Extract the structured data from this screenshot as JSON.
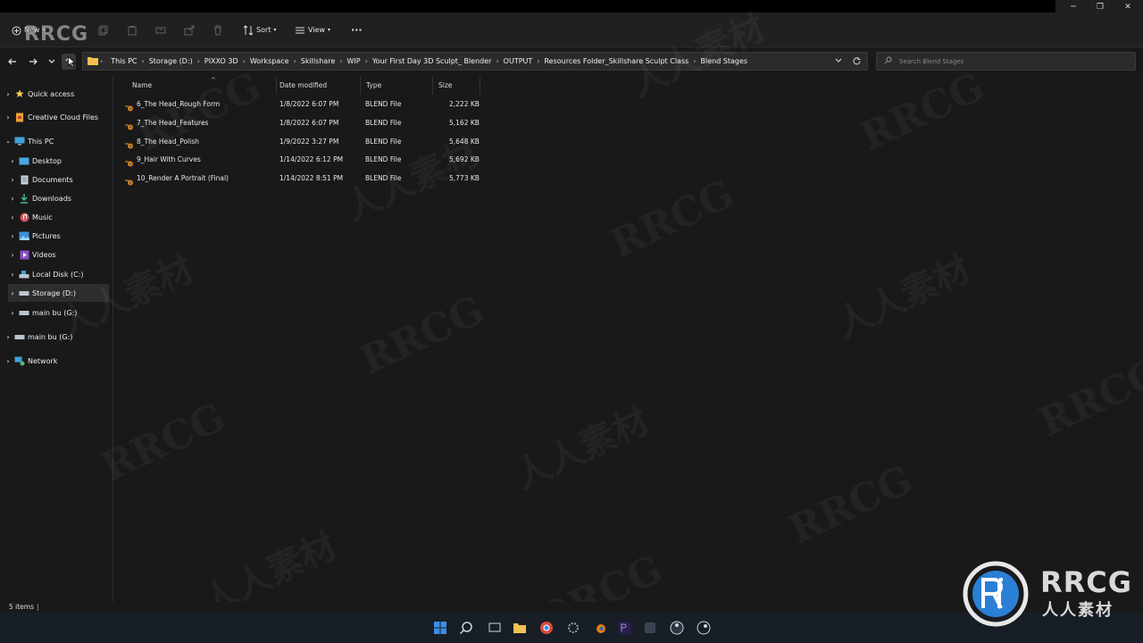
{
  "logo_text": "RRCG",
  "toolbar": {
    "new_label": "New",
    "sort_label": "Sort",
    "view_label": "View",
    "more_label": "···"
  },
  "address": {
    "crumbs": [
      "This PC",
      "Storage (D:)",
      "PIXXO 3D",
      "Workspace",
      "Skillshare",
      "WIP",
      "Your First Day 3D Sculpt_ Blender",
      "OUTPUT",
      "Resources Folder_Skillshare Sculpt Class",
      "Blend Stages"
    ]
  },
  "search": {
    "placeholder": "Search Blend Stages"
  },
  "sidebar": {
    "items": [
      {
        "label": "Quick access"
      },
      {
        "label": "Creative Cloud Files"
      },
      {
        "label": "This PC"
      },
      {
        "label": "Desktop"
      },
      {
        "label": "Documents"
      },
      {
        "label": "Downloads"
      },
      {
        "label": "Music"
      },
      {
        "label": "Pictures"
      },
      {
        "label": "Videos"
      },
      {
        "label": "Local Disk (C:)"
      },
      {
        "label": "Storage (D:)"
      },
      {
        "label": "main bu (G:)"
      },
      {
        "label": "main bu (G:)"
      },
      {
        "label": "Network"
      }
    ]
  },
  "columns": {
    "name": "Name",
    "date": "Date modified",
    "type": "Type",
    "size": "Size"
  },
  "files": [
    {
      "name": "6_The Head_Rough Form",
      "date": "1/8/2022 6:07 PM",
      "type": "BLEND File",
      "size": "2,222 KB"
    },
    {
      "name": "7_The Head_Features",
      "date": "1/8/2022 6:07 PM",
      "type": "BLEND File",
      "size": "5,162 KB"
    },
    {
      "name": "8_The Head_Polish",
      "date": "1/9/2022 3:27 PM",
      "type": "BLEND File",
      "size": "5,648 KB"
    },
    {
      "name": "9_Hair With Curves",
      "date": "1/14/2022 6:12 PM",
      "type": "BLEND File",
      "size": "5,692 KB"
    },
    {
      "name": "10_Render A Portrait (Final)",
      "date": "1/14/2022 8:51 PM",
      "type": "BLEND File",
      "size": "5,773 KB"
    }
  ],
  "status": {
    "count": "5 items"
  },
  "watermark": {
    "latin": "RRCG",
    "cjk": "人人素材"
  },
  "brand": {
    "top": "RRCG",
    "bottom": "人人素材"
  },
  "colors": {
    "accent_blue": "#2b7fd4",
    "blender_orange": "#e87d0d",
    "folder_yellow": "#f2c14e"
  }
}
